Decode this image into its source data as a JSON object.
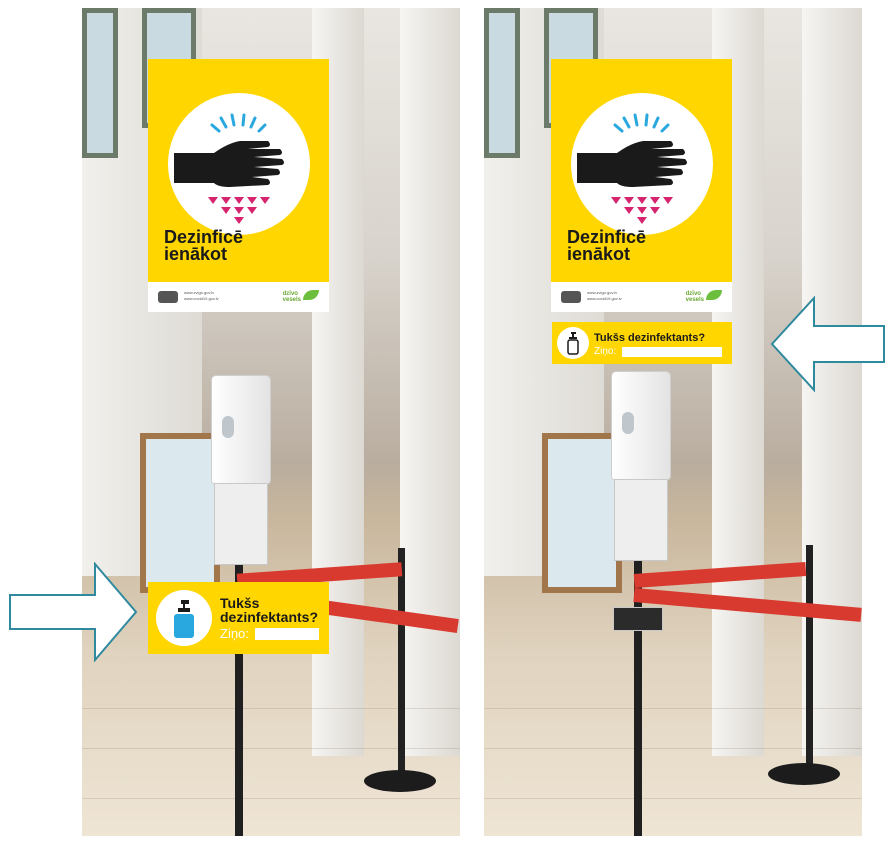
{
  "poster": {
    "title_line1": "Dezinficē",
    "title_line2": "ienākot",
    "url1": "www.zvigo.gov.lv",
    "url2": "www.covid19.gov.lv",
    "brand_line1": "dzīvo",
    "brand_line2": "vesels"
  },
  "sign_left": {
    "line1": "Tukšs",
    "line2": "dezinfektants?",
    "contact_label": "Ziņo:"
  },
  "sign_right": {
    "line1": "Tukšs dezinfektants?",
    "contact_label": "Ziņo:"
  },
  "colors": {
    "sign_yellow": "#ffd600",
    "arrow_outline": "#2f8a9e",
    "ribbon_red": "#d93a30",
    "droplet_magenta": "#d6246e",
    "spray_blue": "#29a8e0"
  }
}
